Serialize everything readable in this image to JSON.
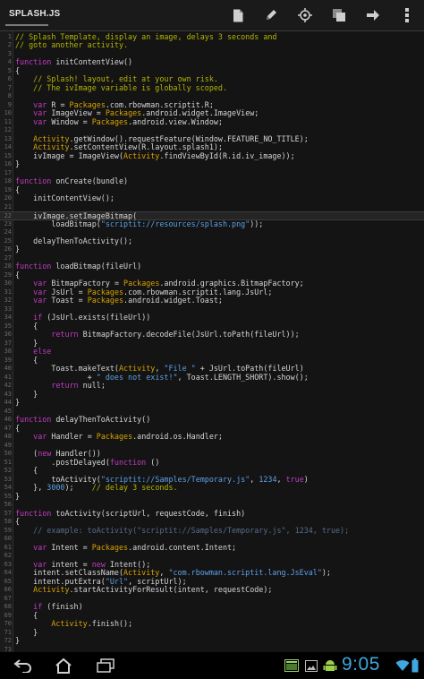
{
  "action_bar": {
    "title": "SPLASH.JS",
    "icons": [
      "file-icon",
      "pencil-icon",
      "target-icon",
      "copy-icon",
      "share-icon",
      "overflow-menu-icon"
    ]
  },
  "editor": {
    "current_line": 22,
    "colors": {
      "background": "#141414",
      "text": "#d6d6d6",
      "comment": "#b4b400",
      "keyword": "#c23cc2",
      "package": "#d8a200",
      "string": "#5ca1e8",
      "line_number": "#686868"
    },
    "lines": [
      [
        {
          "t": "// Splash Template, display an image, delays 3 seconds and",
          "c": "comment"
        }
      ],
      [
        {
          "t": "// goto another activity.",
          "c": "comment"
        }
      ],
      [],
      [
        {
          "t": "function",
          "c": "keyword"
        },
        {
          "t": " initContentView()"
        }
      ],
      [
        {
          "t": "{"
        }
      ],
      [
        {
          "t": "    // Splash! layout, edit at your own risk.",
          "c": "comment"
        }
      ],
      [
        {
          "t": "    // The ivImage variable is globally scoped.",
          "c": "comment"
        }
      ],
      [],
      [
        {
          "t": "    "
        },
        {
          "t": "var",
          "c": "keyword"
        },
        {
          "t": " R = "
        },
        {
          "t": "Packages",
          "c": "pkg"
        },
        {
          "t": ".com.rbowman.scriptit.R;"
        }
      ],
      [
        {
          "t": "    "
        },
        {
          "t": "var",
          "c": "keyword"
        },
        {
          "t": " ImageView = "
        },
        {
          "t": "Packages",
          "c": "pkg"
        },
        {
          "t": ".android.widget.ImageView;"
        }
      ],
      [
        {
          "t": "    "
        },
        {
          "t": "var",
          "c": "keyword"
        },
        {
          "t": " Window = "
        },
        {
          "t": "Packages",
          "c": "pkg"
        },
        {
          "t": ".android.view.Window;"
        }
      ],
      [],
      [
        {
          "t": "    "
        },
        {
          "t": "Activity",
          "c": "cls"
        },
        {
          "t": ".getWindow().requestFeature(Window.FEATURE_NO_TITLE);"
        }
      ],
      [
        {
          "t": "    "
        },
        {
          "t": "Activity",
          "c": "cls"
        },
        {
          "t": ".setContentView(R.layout.splash1);"
        }
      ],
      [
        {
          "t": "    ivImage = ImageView("
        },
        {
          "t": "Activity",
          "c": "cls"
        },
        {
          "t": ".findViewById(R.id.iv_image));"
        }
      ],
      [
        {
          "t": "}"
        }
      ],
      [],
      [
        {
          "t": "function",
          "c": "keyword"
        },
        {
          "t": " onCreate(bundle)"
        }
      ],
      [
        {
          "t": "{"
        }
      ],
      [
        {
          "t": "    initContentView();"
        }
      ],
      [],
      [
        {
          "t": "    ivImage.setImageBitmap("
        }
      ],
      [
        {
          "t": "        loadBitmap("
        },
        {
          "t": "\"scriptit://resources/splash.png\"",
          "c": "string"
        },
        {
          "t": "));"
        }
      ],
      [],
      [
        {
          "t": "    delayThenToActivity();"
        }
      ],
      [
        {
          "t": "}"
        }
      ],
      [],
      [
        {
          "t": "function",
          "c": "keyword"
        },
        {
          "t": " loadBitmap(fileUrl)"
        }
      ],
      [
        {
          "t": "{"
        }
      ],
      [
        {
          "t": "    "
        },
        {
          "t": "var",
          "c": "keyword"
        },
        {
          "t": " BitmapFactory = "
        },
        {
          "t": "Packages",
          "c": "pkg"
        },
        {
          "t": ".android.graphics.BitmapFactory;"
        }
      ],
      [
        {
          "t": "    "
        },
        {
          "t": "var",
          "c": "keyword"
        },
        {
          "t": " JsUrl = "
        },
        {
          "t": "Packages",
          "c": "pkg"
        },
        {
          "t": ".com.rbowman.scriptit.lang.JsUrl;"
        }
      ],
      [
        {
          "t": "    "
        },
        {
          "t": "var",
          "c": "keyword"
        },
        {
          "t": " Toast = "
        },
        {
          "t": "Packages",
          "c": "pkg"
        },
        {
          "t": ".android.widget.Toast;"
        }
      ],
      [],
      [
        {
          "t": "    "
        },
        {
          "t": "if",
          "c": "keyword"
        },
        {
          "t": " (JsUrl.exists(fileUrl))"
        }
      ],
      [
        {
          "t": "    {"
        }
      ],
      [
        {
          "t": "        "
        },
        {
          "t": "return",
          "c": "keyword"
        },
        {
          "t": " BitmapFactory.decodeFile(JsUrl.toPath(fileUrl));"
        }
      ],
      [
        {
          "t": "    }"
        }
      ],
      [
        {
          "t": "    "
        },
        {
          "t": "else",
          "c": "keyword"
        }
      ],
      [
        {
          "t": "    {"
        }
      ],
      [
        {
          "t": "        Toast.makeText("
        },
        {
          "t": "Activity",
          "c": "cls"
        },
        {
          "t": ", "
        },
        {
          "t": "\"File \"",
          "c": "string"
        },
        {
          "t": " + JsUrl.toPath(fileUrl)"
        }
      ],
      [
        {
          "t": "                + "
        },
        {
          "t": "\" does not exist!\"",
          "c": "string"
        },
        {
          "t": ", Toast.LENGTH_SHORT).show();"
        }
      ],
      [
        {
          "t": "        "
        },
        {
          "t": "return",
          "c": "keyword"
        },
        {
          "t": " null;"
        }
      ],
      [
        {
          "t": "    }"
        }
      ],
      [
        {
          "t": "}"
        }
      ],
      [],
      [
        {
          "t": "function",
          "c": "keyword"
        },
        {
          "t": " delayThenToActivity()"
        }
      ],
      [
        {
          "t": "{"
        }
      ],
      [
        {
          "t": "    "
        },
        {
          "t": "var",
          "c": "keyword"
        },
        {
          "t": " Handler = "
        },
        {
          "t": "Packages",
          "c": "pkg"
        },
        {
          "t": ".android.os.Handler;"
        }
      ],
      [],
      [
        {
          "t": "    ("
        },
        {
          "t": "new",
          "c": "keyword"
        },
        {
          "t": " Handler())"
        }
      ],
      [
        {
          "t": "        .postDelayed("
        },
        {
          "t": "function",
          "c": "keyword"
        },
        {
          "t": " ()"
        }
      ],
      [
        {
          "t": "    {"
        }
      ],
      [
        {
          "t": "        toActivity("
        },
        {
          "t": "\"scriptit://Samples/Temporary.js\"",
          "c": "string"
        },
        {
          "t": ", "
        },
        {
          "t": "1234",
          "c": "number"
        },
        {
          "t": ", "
        },
        {
          "t": "true",
          "c": "keyword"
        },
        {
          "t": ")"
        }
      ],
      [
        {
          "t": "    }, "
        },
        {
          "t": "3000",
          "c": "number"
        },
        {
          "t": ");    "
        },
        {
          "t": "// delay 3 seconds.",
          "c": "comment"
        }
      ],
      [
        {
          "t": "}"
        }
      ],
      [],
      [
        {
          "t": "function",
          "c": "keyword"
        },
        {
          "t": " toActivity(scriptUrl, requestCode, finish)"
        }
      ],
      [
        {
          "t": "{"
        }
      ],
      [
        {
          "t": "    // example: toActivity(\"scriptit://Samples/Temporary.js\", 1234, true);",
          "c": "ghost"
        }
      ],
      [],
      [
        {
          "t": "    "
        },
        {
          "t": "var",
          "c": "keyword"
        },
        {
          "t": " Intent = "
        },
        {
          "t": "Packages",
          "c": "pkg"
        },
        {
          "t": ".android.content.Intent;"
        }
      ],
      [],
      [
        {
          "t": "    "
        },
        {
          "t": "var",
          "c": "keyword"
        },
        {
          "t": " intent = "
        },
        {
          "t": "new",
          "c": "keyword"
        },
        {
          "t": " Intent();"
        }
      ],
      [
        {
          "t": "    intent.setClassName("
        },
        {
          "t": "Activity",
          "c": "cls"
        },
        {
          "t": ", "
        },
        {
          "t": "\"com.rbowman.scriptit.lang.JsEval\"",
          "c": "string"
        },
        {
          "t": ");"
        }
      ],
      [
        {
          "t": "    intent.putExtra("
        },
        {
          "t": "\"Url\"",
          "c": "string"
        },
        {
          "t": ", scriptUrl);"
        }
      ],
      [
        {
          "t": "    "
        },
        {
          "t": "Activity",
          "c": "cls"
        },
        {
          "t": ".startActivityForResult(intent, requestCode);"
        }
      ],
      [],
      [
        {
          "t": "    "
        },
        {
          "t": "if",
          "c": "keyword"
        },
        {
          "t": " (finish)"
        }
      ],
      [
        {
          "t": "    {"
        }
      ],
      [
        {
          "t": "        "
        },
        {
          "t": "Activity",
          "c": "cls"
        },
        {
          "t": ".finish();"
        }
      ],
      [
        {
          "t": "    }"
        }
      ],
      [
        {
          "t": "}"
        }
      ],
      []
    ]
  },
  "nav_bar": {
    "buttons": [
      "back-icon",
      "home-icon",
      "recent-apps-icon"
    ],
    "status_icons": [
      "notification-icon",
      "gallery-icon",
      "android-icon",
      "wifi-icon",
      "battery-icon"
    ],
    "clock": "9:05",
    "accent": "#3fa8e0"
  }
}
